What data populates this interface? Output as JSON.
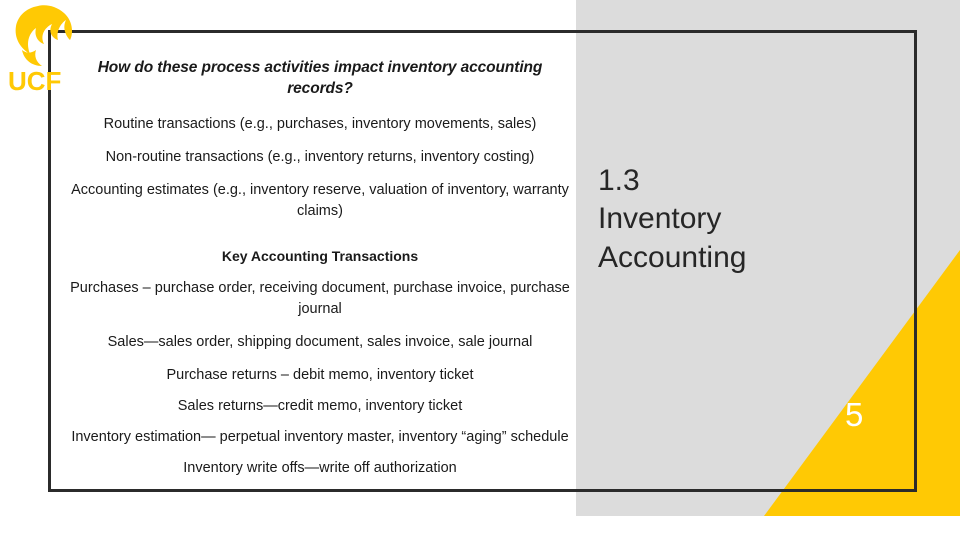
{
  "slide": {
    "logo_alt": "UCF",
    "logo_text": "UCF",
    "heading": "How do these process activities impact inventory accounting records?",
    "bullets": [
      "Routine transactions (e.g., purchases, inventory movements, sales)",
      "Non-routine transactions (e.g., inventory returns, inventory costing)",
      "Accounting estimates (e.g., inventory reserve, valuation of inventory, warranty claims)"
    ],
    "subheading": "Key Accounting Transactions",
    "transactions": [
      "Purchases – purchase order, receiving document, purchase invoice, purchase journal",
      "Sales—sales order, shipping document, sales invoice, sale journal",
      "Purchase returns – debit memo, inventory ticket",
      "Sales returns—credit memo, inventory ticket",
      "Inventory estimation— perpetual inventory master, inventory “aging” schedule",
      "Inventory write offs—write off authorization"
    ],
    "section_number": "1.3",
    "section_title_line1": "Inventory",
    "section_title_line2": "Accounting",
    "page_number": "5",
    "colors": {
      "gold": "#ffc904",
      "gray_panel": "#dcdcdc",
      "box_border": "#2b2b2b",
      "text": "#1a1a1a"
    }
  }
}
